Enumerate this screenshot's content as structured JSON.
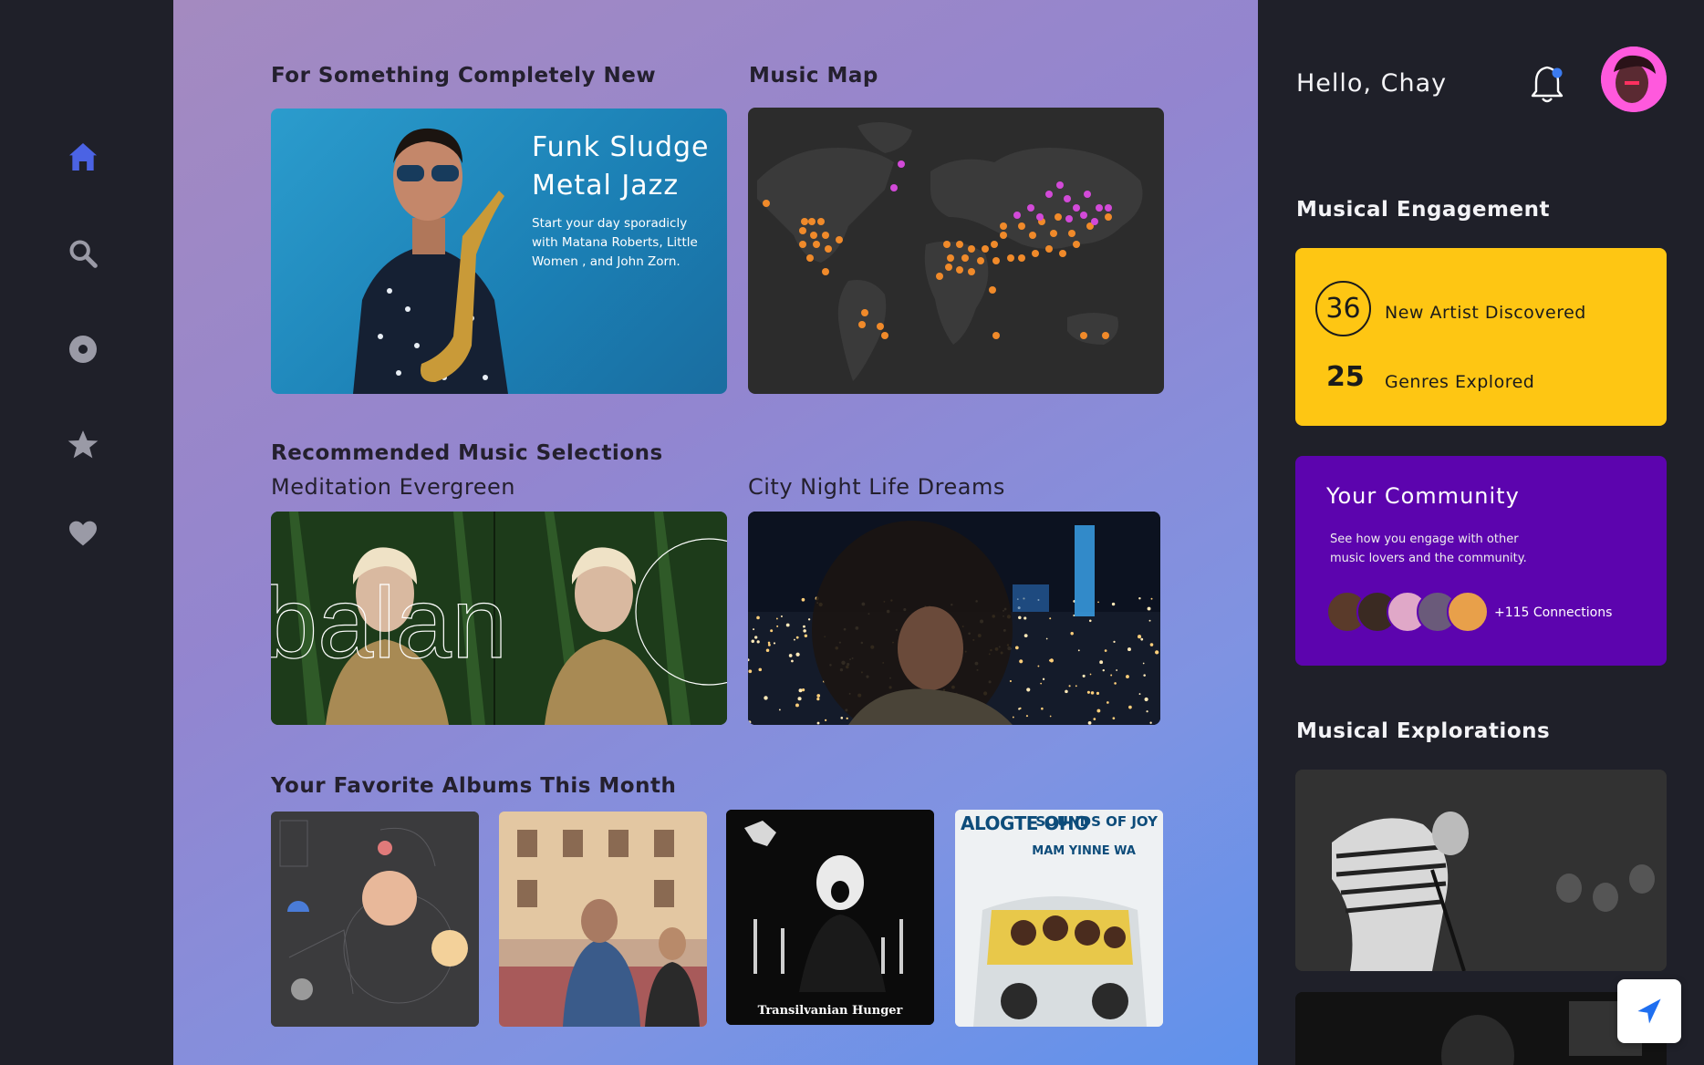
{
  "nav": {
    "items": [
      {
        "icon": "home-icon",
        "active": true
      },
      {
        "icon": "search-icon",
        "active": false
      },
      {
        "icon": "disc-icon",
        "active": false
      },
      {
        "icon": "star-icon",
        "active": false
      },
      {
        "icon": "heart-icon",
        "active": false
      }
    ],
    "active_color": "#4b63e4",
    "inactive_color": "#9a9aa6"
  },
  "main": {
    "featured_title": "For Something Completely New",
    "featured_card": {
      "title": "Funk Sludge Metal Jazz",
      "description": "Start your day sporadicly with Matana Roberts, Little Women , and John Zorn."
    },
    "map_title": "Music Map",
    "recommended_title": "Recommended Music Selections",
    "recommended": [
      {
        "title": "Meditation Evergreen"
      },
      {
        "title": "City Night Life Dreams"
      }
    ],
    "albums_title": "Your Favorite Albums This Month",
    "albums": [
      {
        "cover_text": ""
      },
      {
        "cover_text": ""
      },
      {
        "cover_text": "Transilvanian Hunger"
      },
      {
        "cover_text": "ALOGTE OHO",
        "cover_text_2": "SOUNDS OF JOY",
        "cover_text_3": "MAM YINNE WA"
      }
    ]
  },
  "right": {
    "greeting": "Hello, Chay",
    "engagement_title": "Musical Engagement",
    "engagement": {
      "artists_count": "36",
      "artists_label": "New Artist Discovered",
      "genres_count": "25",
      "genres_label": "Genres Explored",
      "bg_color": "#fec613"
    },
    "community": {
      "title": "Your Community",
      "description": "See how you engage with other music lovers and the community.",
      "connections": "+115 Connections",
      "bg_color": "#5c04ae"
    },
    "explorations_title": "Musical Explorations"
  }
}
